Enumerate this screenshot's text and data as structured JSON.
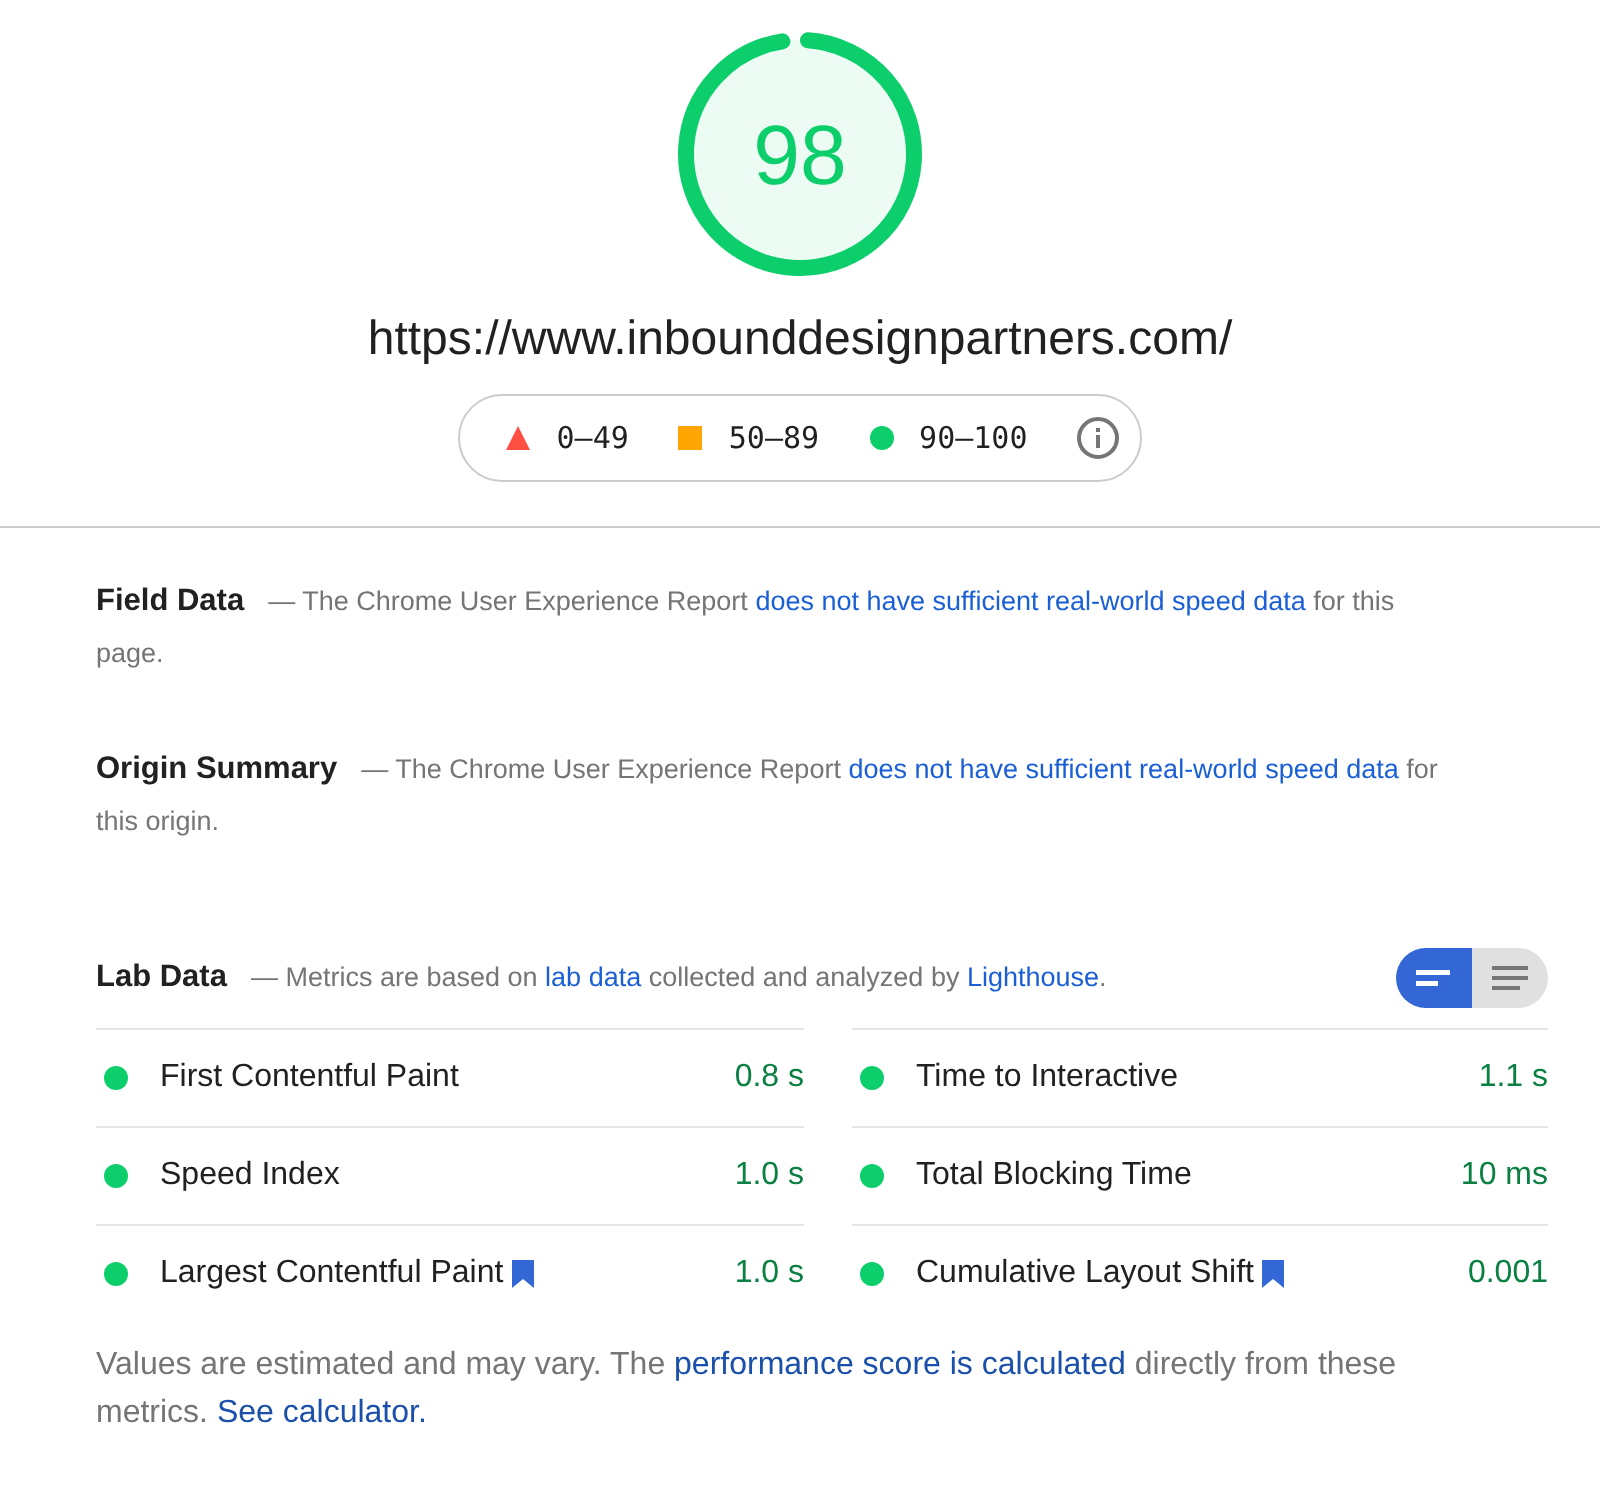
{
  "score": {
    "value": "98",
    "color": "#0cce6b"
  },
  "url": "https://www.inbounddesignpartners.com/",
  "legend": [
    {
      "kind": "fail",
      "label": "0–49"
    },
    {
      "kind": "average",
      "label": "50–89"
    },
    {
      "kind": "pass",
      "label": "90–100"
    }
  ],
  "sections": [
    {
      "title": "Field Data",
      "description": [
        {
          "kind": "text",
          "text": "— The Chrome User Experience Report "
        },
        {
          "kind": "link",
          "text": "does not have sufficient real-world speed data"
        },
        {
          "kind": "text",
          "text": " for this page."
        }
      ]
    },
    {
      "title": "Origin Summary",
      "description": [
        {
          "kind": "text",
          "text": "— The Chrome User Experience Report "
        },
        {
          "kind": "link",
          "text": "does not have sufficient real-world speed data"
        },
        {
          "kind": "text",
          "text": " for this origin."
        }
      ]
    }
  ],
  "lab_data": {
    "title": "Lab Data",
    "description": [
      {
        "kind": "text",
        "text": "— Metrics are based on "
      },
      {
        "kind": "link",
        "text": "lab data"
      },
      {
        "kind": "text",
        "text": " collected and analyzed by "
      },
      {
        "kind": "link",
        "text": "Lighthouse"
      },
      {
        "kind": "text",
        "text": "."
      }
    ],
    "view_toggle": [
      {
        "kind": "summary",
        "selected": true
      },
      {
        "kind": "list",
        "selected": false
      }
    ],
    "metrics": [
      {
        "name": "First Contentful Paint",
        "value": "0.8 s",
        "color": "#0cce6b",
        "flagged": false
      },
      {
        "name": "Time to Interactive",
        "value": "1.1 s",
        "color": "#0cce6b",
        "flagged": false
      },
      {
        "name": "Speed Index",
        "value": "1.0 s",
        "color": "#0cce6b",
        "flagged": false
      },
      {
        "name": "Total Blocking Time",
        "value": "10 ms",
        "color": "#0cce6b",
        "flagged": false
      },
      {
        "name": "Largest Contentful Paint",
        "value": "1.0 s",
        "color": "#0cce6b",
        "flagged": true
      },
      {
        "name": "Cumulative Layout Shift",
        "value": "0.001",
        "color": "#0cce6b",
        "flagged": true
      }
    ]
  },
  "footer": [
    {
      "kind": "text",
      "text": "Values are estimated and may vary. The "
    },
    {
      "kind": "link",
      "text": "performance score is calculated"
    },
    {
      "kind": "text",
      "text": " directly from these metrics. "
    },
    {
      "kind": "link",
      "text": "See calculator."
    }
  ]
}
